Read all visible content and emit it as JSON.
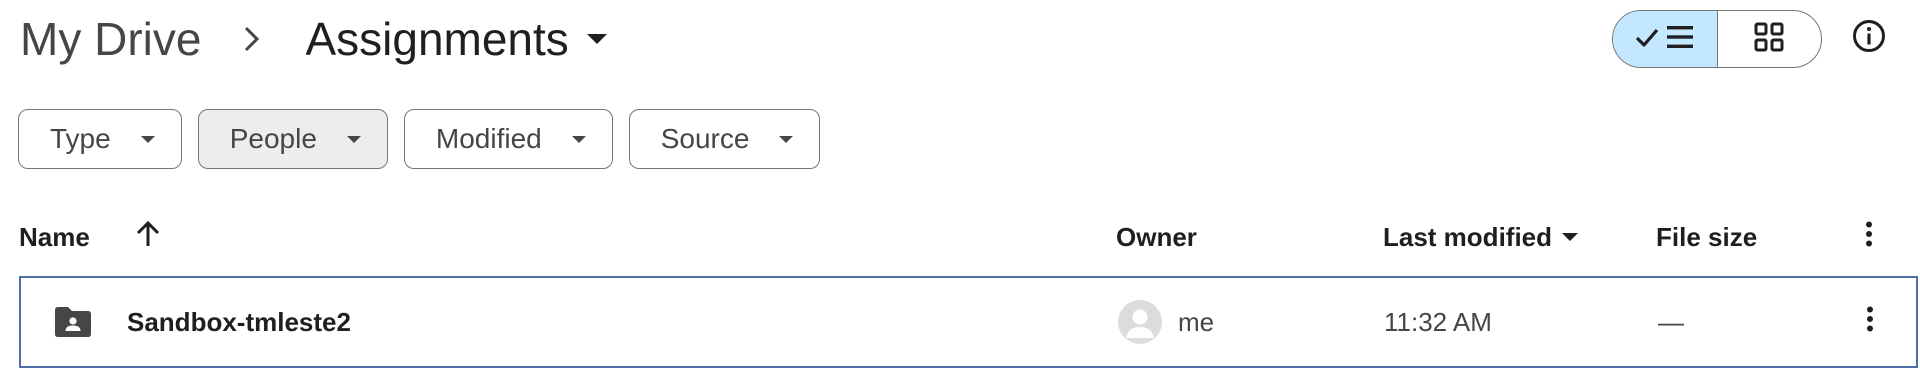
{
  "breadcrumb": {
    "root": "My Drive",
    "current": "Assignments",
    "separator_icon": "chevron-right-icon",
    "current_icon": "caret-down-icon"
  },
  "view_toggle": {
    "active": "list",
    "list_icon": "check-list-icon",
    "grid_icon": "grid-icon",
    "active_color": "#c2e7ff"
  },
  "info_icon": "info-icon",
  "filters": [
    {
      "label": "Type"
    },
    {
      "label": "People"
    },
    {
      "label": "Modified"
    },
    {
      "label": "Source"
    }
  ],
  "table": {
    "headers": {
      "name": "Name",
      "owner": "Owner",
      "last_modified": "Last modified",
      "file_size": "File size"
    },
    "sort_icon": "arrow-up-icon",
    "more_icon": "more-vert-icon",
    "rows": [
      {
        "icon": "shared-folder-icon",
        "name": "Sandbox-tmleste2",
        "owner": "me",
        "owner_icon": "avatar-icon",
        "last_modified": "11:32 AM",
        "file_size": "—"
      }
    ]
  },
  "colors": {
    "selection_border": "#4e6fa8",
    "text_primary": "#1f1f1f",
    "text_secondary": "#444746"
  }
}
